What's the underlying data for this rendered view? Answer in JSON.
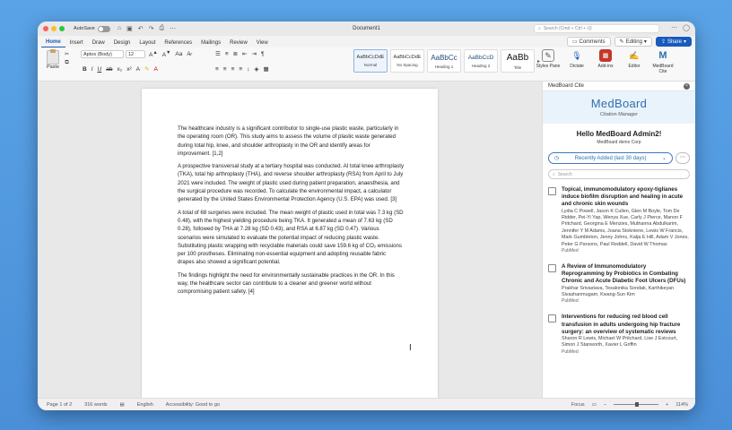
{
  "titlebar": {
    "autosave": "AutoSave",
    "doc_title": "Document1",
    "search_placeholder": "Search (Cmd + Ctrl + U)"
  },
  "ribbon_tabs": [
    "Home",
    "Insert",
    "Draw",
    "Design",
    "Layout",
    "References",
    "Mailings",
    "Review",
    "View"
  ],
  "ribbon_actions": {
    "comments": "Comments",
    "editing": "Editing",
    "share": "Share"
  },
  "ribbon": {
    "paste": "Paste",
    "font": "Aptos (Body)",
    "size": "12",
    "styles": [
      {
        "preview": "AaBbCcDdE",
        "name": "Normal"
      },
      {
        "preview": "AaBbCcDdE",
        "name": "No Spacing"
      },
      {
        "preview": "AaBbCc",
        "name": "Heading 1"
      },
      {
        "preview": "AaBbCcD",
        "name": "Heading 2"
      },
      {
        "preview": "AaBb",
        "name": "Title"
      }
    ],
    "tools": [
      {
        "label": "Styles Pane",
        "icon": "styles-pane-icon"
      },
      {
        "label": "Dictate",
        "icon": "microphone-icon"
      },
      {
        "label": "Add-ins",
        "icon": "add-ins-icon"
      },
      {
        "label": "Editor",
        "icon": "editor-icon"
      },
      {
        "label": "MedBoard Cite",
        "icon": "medboard-icon"
      }
    ]
  },
  "document": {
    "paragraphs": [
      "The healthcare industry is a significant contributor to single-use plastic waste, particularly in the operating room (OR). This study aims to assess the volume of plastic waste generated during total hip, knee, and shoulder arthroplasty in the OR and identify areas for improvement. [1,2]",
      "A prospective transversal study at a tertiary hospital was conducted. AI total knee arthroplasty (TKA), total hip arthroplasty (THA), and reverse shoulder arthroplasty (RSA) from April to July 2021 were included. The weight of plastic used during patient preparation, anaesthesia, and the surgical procedure was recorded. To calculate the environmental impact, a calculator generated by the United States Environmental Protection Agency (U.S. EPA) was used. [3]",
      "A total of 68 surgeries were included. The mean weight of plastic used in total was 7.3 kg (SD 0.48), with the highest yielding procedure being TKA. It generated a mean of 7.63 kg (SD 0.28), followed by THA at 7.28 kg (SD 0.43), and RSA at 6.87 kg (SD 0.47). Various scenarios were simulated to evaluate the potential impact of reducing plastic waste. Substituting plastic wrapping with recyclable materials could save 159.6 kg of CO₂ emissions per 100 prostheses. Eliminating non-essential equipment and adopting reusable fabric drapes also showed a significant potential.",
      "The findings highlight the need for environmentally sustainable practices in the OR. In this way, the healthcare sector can contribute to a cleaner and greener world without compromising patient safety. [4]"
    ]
  },
  "pane": {
    "title": "MedBoard Cite",
    "logo": "MedBoard",
    "subtitle": "Citation Manager",
    "greeting": "Hello MedBoard Admin2!",
    "org": "MedBoard demo Corp",
    "filter": "Recently Added (last 30 days)",
    "search_placeholder": "Search",
    "items": [
      {
        "title": "Topical, immunomodulatory epoxy-tiglianes induce biofilm disruption and healing in acute and chronic skin wounds",
        "authors": "Lydia C Powell, Jason K Cullen, Glen M Boyle, Tom De Ridder, Pei-Yi Yap, Wenya Xue, Carly J Pierce, Manon F Pritchard, Georgina E Menzies, Muthanna Abdulkarim, Jennifer Y M Adams, Joana Stokniene, Lewis W Francis, Mark Gumbleton, Jenny Johns, Katja E Hill, Adam V Jones, Peter G Parsons, Paul Reddell, David W Thomas",
        "source": "PubMed"
      },
      {
        "title": "A Review of Immunomodulatory Reprogramming by Probiotics in Combating Chronic and Acute Diabetic Foot Ulcers (DFUs)",
        "authors": "Prakhar Srivastava, Tesalonika Sondak, Karthikeyan Sivashanmugam, Kwang-Sun Kim",
        "source": "PubMed"
      },
      {
        "title": "Interventions for reducing red blood cell transfusion in adults undergoing hip fracture surgery: an overview of systematic reviews",
        "authors": "Sharon R Lewis, Michael W Pritchard, Lise J Estcourt, Simon J Stanworth, Xavier L Griffin",
        "source": "PubMed"
      }
    ]
  },
  "status": {
    "page": "Page 1 of 2",
    "words": "316 words",
    "language": "English",
    "accessibility": "Accessibility: Good to go",
    "focus": "Focus",
    "zoom": "114%"
  }
}
